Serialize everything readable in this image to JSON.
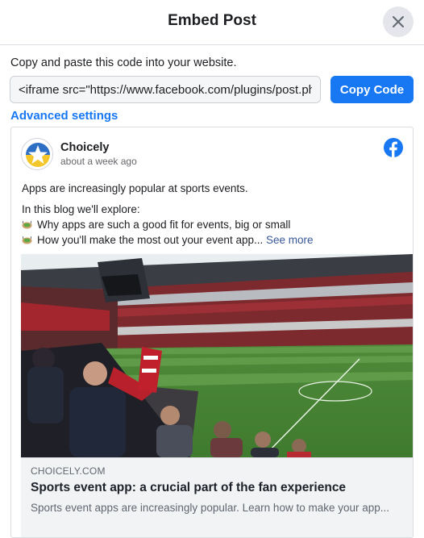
{
  "dialog": {
    "title": "Embed Post",
    "instruction": "Copy and paste this code into your website.",
    "code_value": "<iframe src=\"https://www.facebook.com/plugins/post.php?href=",
    "copy_button": "Copy Code",
    "advanced_link": "Advanced settings"
  },
  "post": {
    "author": "Choicely",
    "timestamp": "about a week ago",
    "text_line_1": "Apps are increasingly popular at sports events.",
    "text_line_2": "In this blog we'll explore:",
    "bullet_1": "Why apps are such a good fit for events, big or small",
    "bullet_2": "How you'll make the most out your event app...",
    "see_more": "See more",
    "link": {
      "domain": "CHOICELY.COM",
      "title": "Sports event app: a crucial part of the fan experience",
      "description": "Sports event apps are increasingly popular. Learn how to make your app..."
    }
  },
  "colors": {
    "accent": "#1877f2",
    "text": "#1c1e21",
    "muted": "#65676b",
    "card_bg": "#f2f3f5"
  },
  "icons": {
    "close": "close-icon",
    "facebook": "facebook-logo-icon",
    "bullet": "stadium-emoji-icon",
    "avatar": "choicely-star-logo"
  }
}
